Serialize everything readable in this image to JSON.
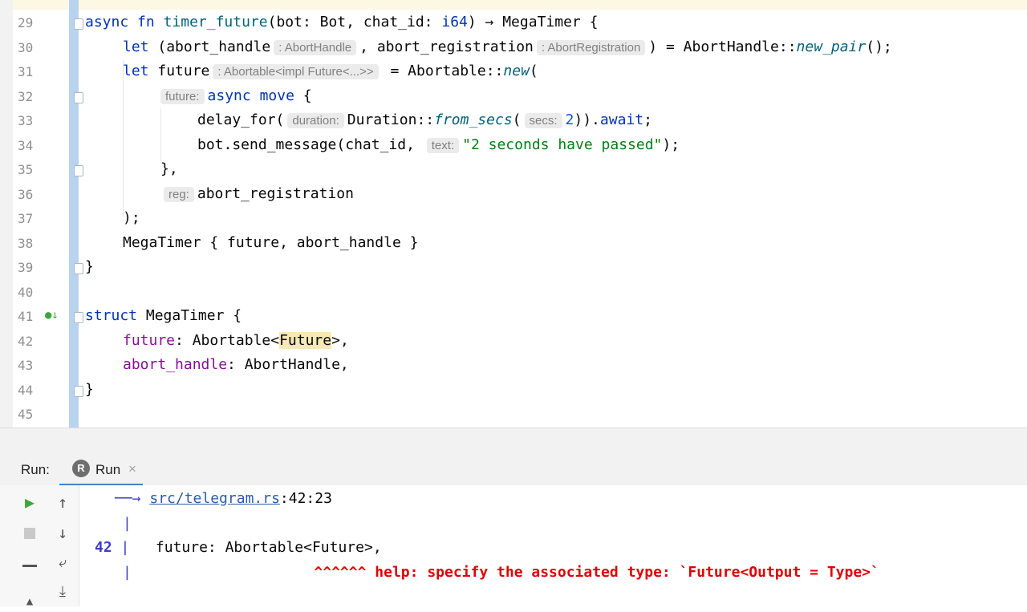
{
  "editor": {
    "lines": [
      {
        "n": "29"
      },
      {
        "n": "30"
      },
      {
        "n": "31"
      },
      {
        "n": "32"
      },
      {
        "n": "33"
      },
      {
        "n": "34"
      },
      {
        "n": "35"
      },
      {
        "n": "36"
      },
      {
        "n": "37"
      },
      {
        "n": "38"
      },
      {
        "n": "39"
      },
      {
        "n": "40"
      },
      {
        "n": "41"
      },
      {
        "n": "42"
      },
      {
        "n": "43"
      },
      {
        "n": "44"
      },
      {
        "n": "45"
      }
    ],
    "code": {
      "l29": {
        "async": "async",
        "fn": "fn",
        "name": "timer_future",
        "params_a": "(bot: Bot, chat_id: ",
        "i64": "i64",
        "params_b": ") → MegaTimer {"
      },
      "l30": {
        "let": "let",
        "a": " (abort_handle",
        "hint1": ": AbortHandle",
        "b": ", abort_registration",
        "hint2": ": AbortRegistration",
        "c": ") = AbortHandle::",
        "fn": "new_pair",
        "d": "();"
      },
      "l31": {
        "let": "let",
        "a": " future",
        "hint": ": Abortable<impl Future<...>>",
        "b": " = Abortable::",
        "fn": "new",
        "c": "("
      },
      "l32": {
        "hint": "future:",
        "async": "async",
        "move": "move",
        "c": " {"
      },
      "l33": {
        "a": "delay_for(",
        "hint": "duration:",
        "b": "Duration::",
        "fn": "from_secs",
        "c": "(",
        "hint2": "secs:",
        "num": "2",
        "d": ")).",
        "await": "await",
        "e": ";"
      },
      "l34": {
        "a": "bot.send_message(chat_id, ",
        "hint": "text:",
        "str": "\"2 seconds have passed\"",
        "b": ");"
      },
      "l35": {
        "a": "},"
      },
      "l36": {
        "hint": "reg:",
        "a": "abort_registration"
      },
      "l37": {
        "a": ");"
      },
      "l38": {
        "a": "MegaTimer { future, abort_handle }"
      },
      "l39": {
        "a": "}"
      },
      "l41": {
        "struct": "struct",
        "a": " MegaTimer {"
      },
      "l42": {
        "field": "future",
        "a": ": Abortable<",
        "hl": "Future",
        "b": ">,"
      },
      "l43": {
        "field": "abort_handle",
        "a": ": AbortHandle,"
      },
      "l44": {
        "a": "}"
      }
    }
  },
  "run_panel": {
    "label": "Run:",
    "tab_label": "Run",
    "tab_close": "×",
    "rust_icon": "R",
    "output": {
      "arrow": "──→",
      "link": "src/telegram.rs",
      "location": ":42:23",
      "pipe": "|",
      "line_num": "42",
      "code_line": "future: Abortable<Future>,",
      "carets": "^^^^^^",
      "help": "help: specify the associated type: `Future<Output = Type>`"
    },
    "icons": {
      "run": "play-icon",
      "stop": "stop-icon",
      "up": "up-arrow-icon",
      "down": "down-arrow-icon",
      "wrap": "soft-wrap-icon",
      "layout": "layout-icon",
      "scroll": "scroll-to-end-icon"
    }
  },
  "colors": {
    "keyword": "#0033b3",
    "function": "#00627a",
    "string": "#067d17",
    "field": "#871094",
    "error": "#e00000",
    "link": "#2d5ca8"
  }
}
